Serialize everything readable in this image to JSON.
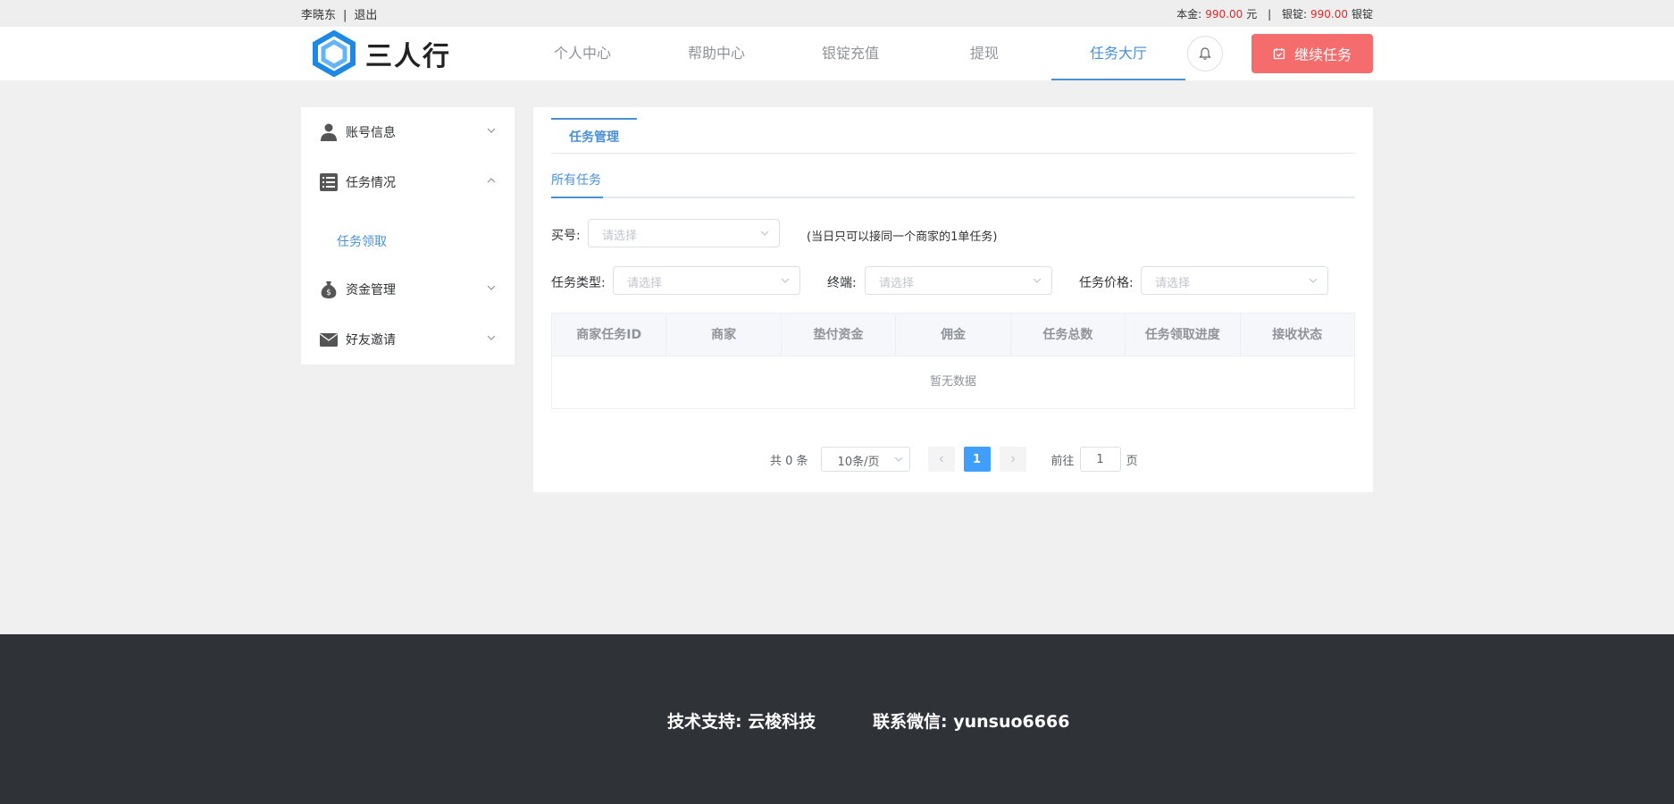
{
  "topbar": {
    "username": "李晓东",
    "separator": "|",
    "logout": "退出",
    "principal_label": "本金:",
    "principal_value": "990.00",
    "principal_unit": "元",
    "divider": "|",
    "ingot_label": "银锭:",
    "ingot_value": "990.00",
    "ingot_unit": "银锭"
  },
  "header": {
    "logo_text": "三人行",
    "nav": [
      "个人中心",
      "帮助中心",
      "银锭充值",
      "提现",
      "任务大厅"
    ],
    "active_nav": "任务大厅",
    "continue_button": "继续任务"
  },
  "sidebar": {
    "items": [
      {
        "label": "账号信息",
        "icon": "user-icon",
        "expanded": false
      },
      {
        "label": "任务情况",
        "icon": "list-icon",
        "expanded": true
      },
      {
        "label": "资金管理",
        "icon": "money-bag-icon",
        "expanded": false
      },
      {
        "label": "好友邀请",
        "icon": "envelope-icon",
        "expanded": false
      }
    ],
    "sub_item": "任务领取"
  },
  "main": {
    "tab_primary": "任务管理",
    "tab_secondary": "所有任务",
    "filters": {
      "buyer_label": "买号:",
      "buyer_placeholder": "请选择",
      "buyer_hint": "(当日只可以接同一个商家的1单任务)",
      "type_label": "任务类型:",
      "type_placeholder": "请选择",
      "terminal_label": "终端:",
      "terminal_placeholder": "请选择",
      "price_label": "任务价格:",
      "price_placeholder": "请选择"
    },
    "table": {
      "columns": [
        "商家任务ID",
        "商家",
        "垫付资金",
        "佣金",
        "任务总数",
        "任务领取进度",
        "接收状态"
      ],
      "rows": [],
      "empty_text": "暂无数据"
    },
    "pagination": {
      "total_text": "共 0 条",
      "page_size": "10条/页",
      "current_page": "1",
      "goto_label": "前往",
      "goto_value": "1",
      "page_unit": "页"
    }
  },
  "footer": {
    "support": "技术支持: 云梭科技",
    "contact": "联系微信: yunsuo6666"
  },
  "colors": {
    "accent": "#4a90d9",
    "danger_button": "#f56c6c",
    "money": "#e02b2b",
    "footer_bg": "#2f3337",
    "page_active": "#409eff"
  }
}
